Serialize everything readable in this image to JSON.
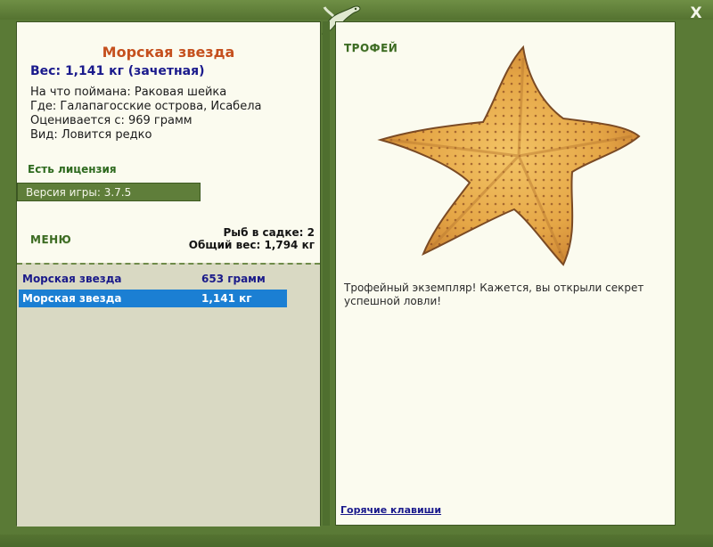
{
  "window": {
    "close_label": "X"
  },
  "fish": {
    "name": "Морская звезда",
    "weight_line": "Вес: 1,141 кг (зачетная)",
    "caught_on": "На что поймана: Раковая шейка",
    "location": "Где: Галапагосские острова, Исабела",
    "valued_from": "Оценивается с: 969 грамм",
    "species_rarity": "Вид: Ловится редко"
  },
  "license": "Есть лицензия",
  "version": "Версия игры: 3.7.5",
  "menu_label": "МЕНЮ",
  "cage": {
    "count_line": "Рыб в садке: 2",
    "total_weight_line": "Общий вес: 1,794 кг"
  },
  "catch_list": [
    {
      "name": "Морская звезда",
      "weight": "653 грамм"
    },
    {
      "name": "Морская звезда",
      "weight": "1,141 кг"
    }
  ],
  "trophy": {
    "label": "ТРОФЕЙ",
    "message": "Трофейный экземпляр! Кажется, вы открыли секрет успешной ловли!"
  },
  "hotkeys_label": "Горячие клавиши",
  "colors": {
    "frame": "#5a7a36",
    "panel_bg": "#fbfbef",
    "title_orange": "#c5501e",
    "link_blue": "#1a1a8c",
    "selected_row": "#1b7fd3"
  }
}
